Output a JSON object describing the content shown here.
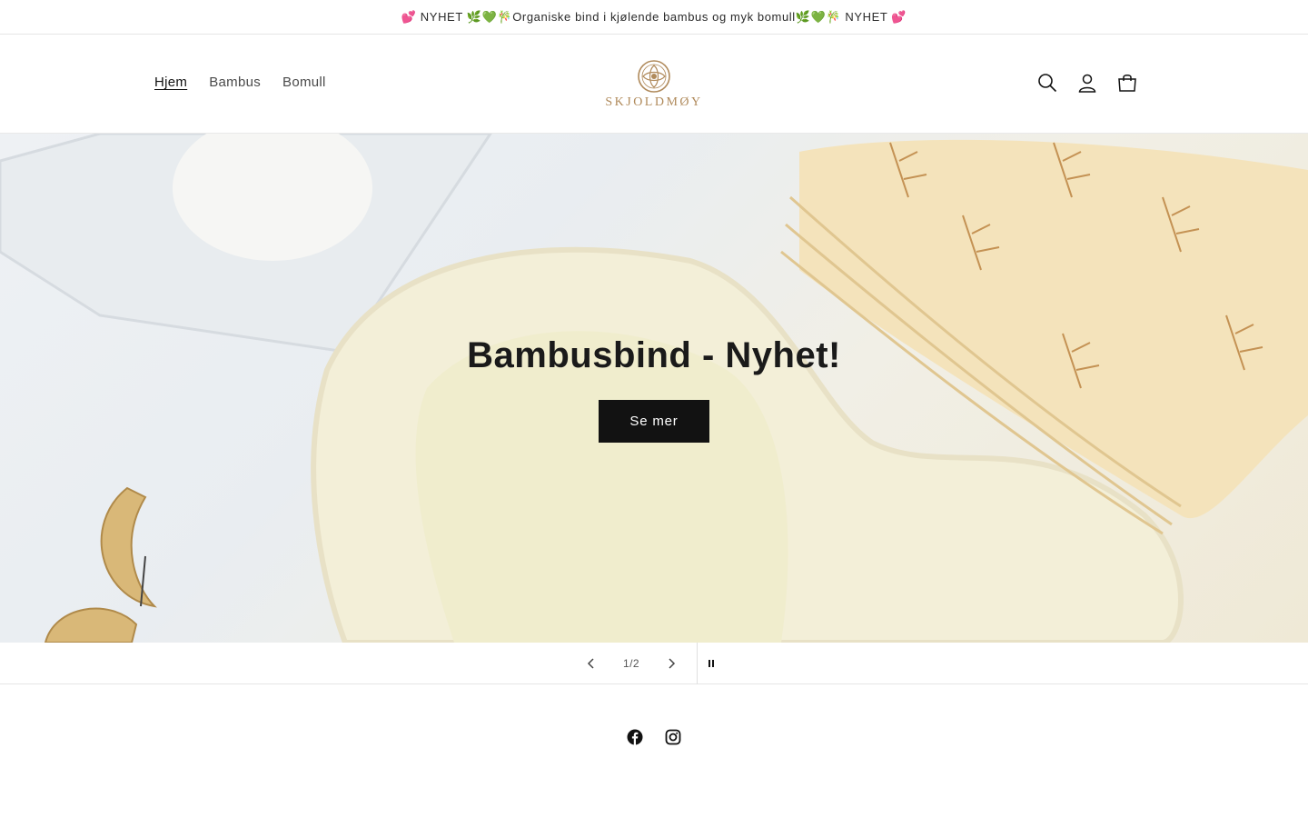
{
  "announcement": {
    "text": "💕 NYHET 🌿💚🎋Organiske bind i kjølende bambus og myk bomull🌿💚🎋 NYHET 💕"
  },
  "header": {
    "nav": [
      {
        "label": "Hjem",
        "active": true
      },
      {
        "label": "Bambus",
        "active": false
      },
      {
        "label": "Bomull",
        "active": false
      }
    ],
    "logo_text": "SKJOLDMØY",
    "icons": [
      "search-icon",
      "account-icon",
      "cart-icon"
    ]
  },
  "hero": {
    "title": "Bambusbind - Nyhet!",
    "button_label": "Se mer"
  },
  "slider": {
    "counter": "1/2",
    "icons": [
      "chevron-left-icon",
      "chevron-right-icon",
      "pause-icon"
    ]
  },
  "footer": {
    "social_icons": [
      "facebook-icon",
      "instagram-icon"
    ]
  },
  "colors": {
    "brand": "#b08a5b",
    "button": "#121212"
  }
}
